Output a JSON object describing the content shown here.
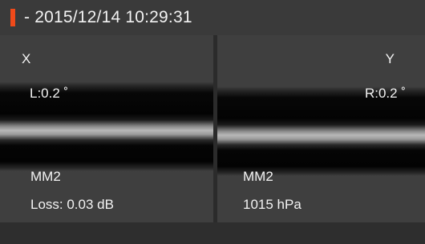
{
  "status_bar": {
    "timestamp": "- 2015/12/14 10:29:31",
    "marker_color": "#f04a1a"
  },
  "left_view": {
    "axis_label": "X",
    "angle": "L:0.2 ˚",
    "fiber_mode": "MM2",
    "loss": "Loss: 0.03 dB"
  },
  "right_view": {
    "axis_label": "Y",
    "angle": "R:0.2 ˚",
    "fiber_mode": "MM2",
    "pressure": "1015 hPa"
  }
}
